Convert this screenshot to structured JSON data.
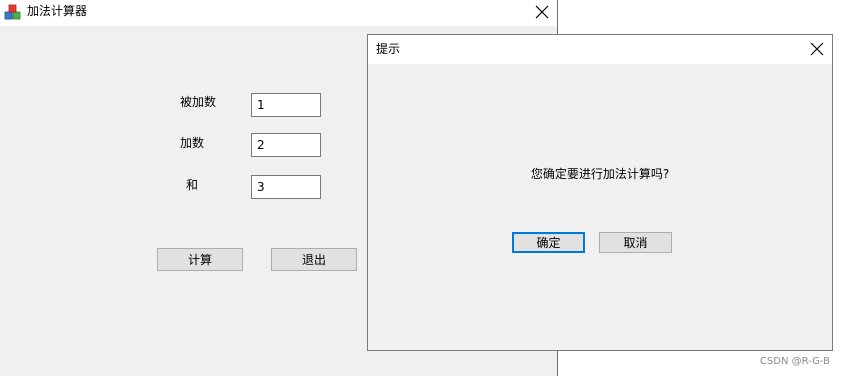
{
  "main_window": {
    "title": "加法计算器",
    "icon": "app-calculator-icon",
    "fields": [
      {
        "label": "被加数",
        "value": "1"
      },
      {
        "label": "加数",
        "value": "2"
      },
      {
        "label": "和",
        "value": "3"
      }
    ],
    "buttons": {
      "calculate": "计算",
      "exit": "退出"
    }
  },
  "dialog": {
    "title": "提示",
    "message": "您确定要进行加法计算吗?",
    "buttons": {
      "ok": "确定",
      "cancel": "取消"
    }
  },
  "watermark": "CSDN @R-G-B",
  "colors": {
    "window_bg": "#f0f0f0",
    "default_button_border": "#0078d7"
  }
}
